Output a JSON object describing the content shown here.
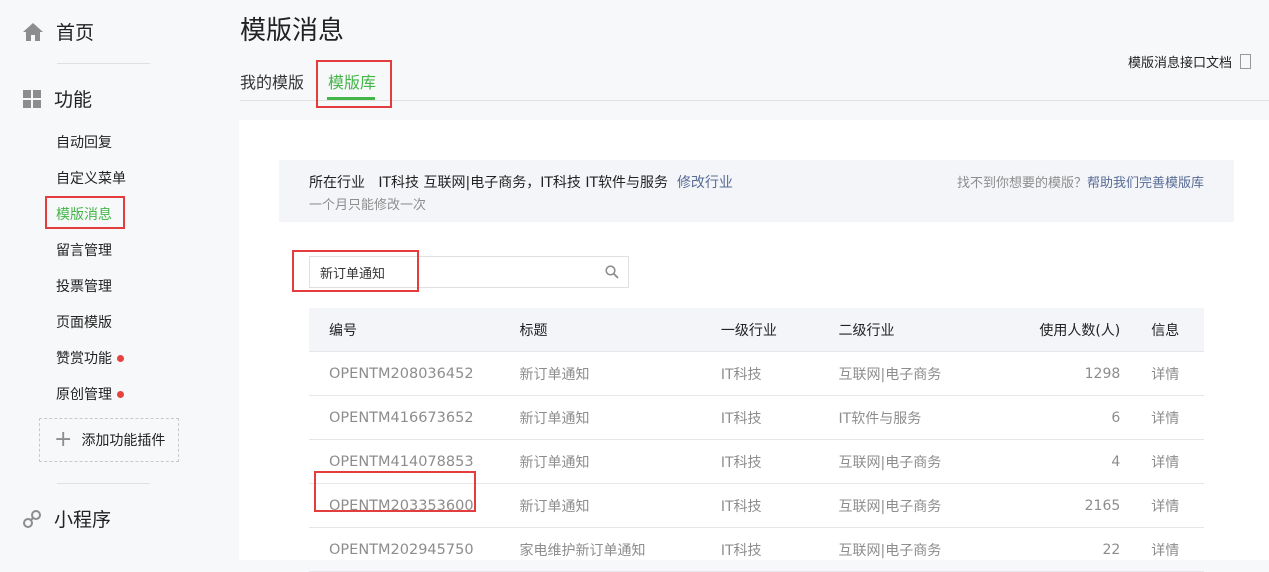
{
  "sidebar": {
    "home": "首页",
    "functions": "功能",
    "items": [
      {
        "label": "自动回复"
      },
      {
        "label": "自定义菜单"
      },
      {
        "label": "模版消息"
      },
      {
        "label": "留言管理"
      },
      {
        "label": "投票管理"
      },
      {
        "label": "页面模版"
      },
      {
        "label": "赞赏功能"
      },
      {
        "label": "原创管理"
      }
    ],
    "add_plugin": "添加功能插件",
    "mini_program": "小程序"
  },
  "header": {
    "title": "模版消息",
    "doc_link": "模版消息接口文档",
    "tabs": [
      "我的模版",
      "模版库"
    ]
  },
  "industry": {
    "label": "所在行业",
    "value": "IT科技 互联网|电子商务，IT科技 IT软件与服务",
    "edit_link": "修改行业",
    "note": "一个月只能修改一次",
    "help_text": "找不到你想要的模版？",
    "help_link": "帮助我们完善模版库"
  },
  "search": {
    "value": "新订单通知",
    "placeholder": "新订单通知"
  },
  "table": {
    "headers": [
      "编号",
      "标题",
      "一级行业",
      "二级行业",
      "使用人数(人)",
      "信息"
    ],
    "rows": [
      [
        "OPENTM208036452",
        "新订单通知",
        "IT科技",
        "互联网|电子商务",
        "1298",
        "详情"
      ],
      [
        "OPENTM416673652",
        "新订单通知",
        "IT科技",
        "IT软件与服务",
        "6",
        "详情"
      ],
      [
        "OPENTM414078853",
        "新订单通知",
        "IT科技",
        "互联网|电子商务",
        "4",
        "详情"
      ],
      [
        "OPENTM203353600",
        "新订单通知",
        "IT科技",
        "互联网|电子商务",
        "2165",
        "详情"
      ],
      [
        "OPENTM202945750",
        "家电维护新订单通知",
        "IT科技",
        "互联网|电子商务",
        "22",
        "详情"
      ]
    ]
  },
  "colors": {
    "accent": "#44b549",
    "link": "#576b95",
    "highlight_box": "#e43d3d",
    "dot": "#e64340"
  }
}
